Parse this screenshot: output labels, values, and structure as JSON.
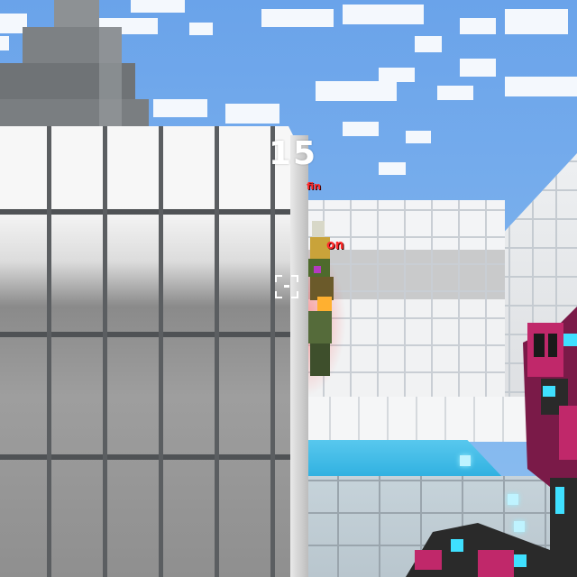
{
  "hud": {
    "ammo": "15",
    "crosshair_icon": "crosshair-icon"
  },
  "enemy_names": {
    "tag_far": "fin",
    "tag_near": "on"
  },
  "colors": {
    "nametag": "#ff2a2a",
    "sky": "#6aa3ea",
    "pool": "#3dbbe6",
    "weapon_primary": "#c0286a",
    "weapon_accent": "#3fe0ff"
  },
  "icons": {
    "crosshair": "crosshair-icon",
    "weapon": "weapon-icon",
    "player": "enemy-player-icon"
  }
}
